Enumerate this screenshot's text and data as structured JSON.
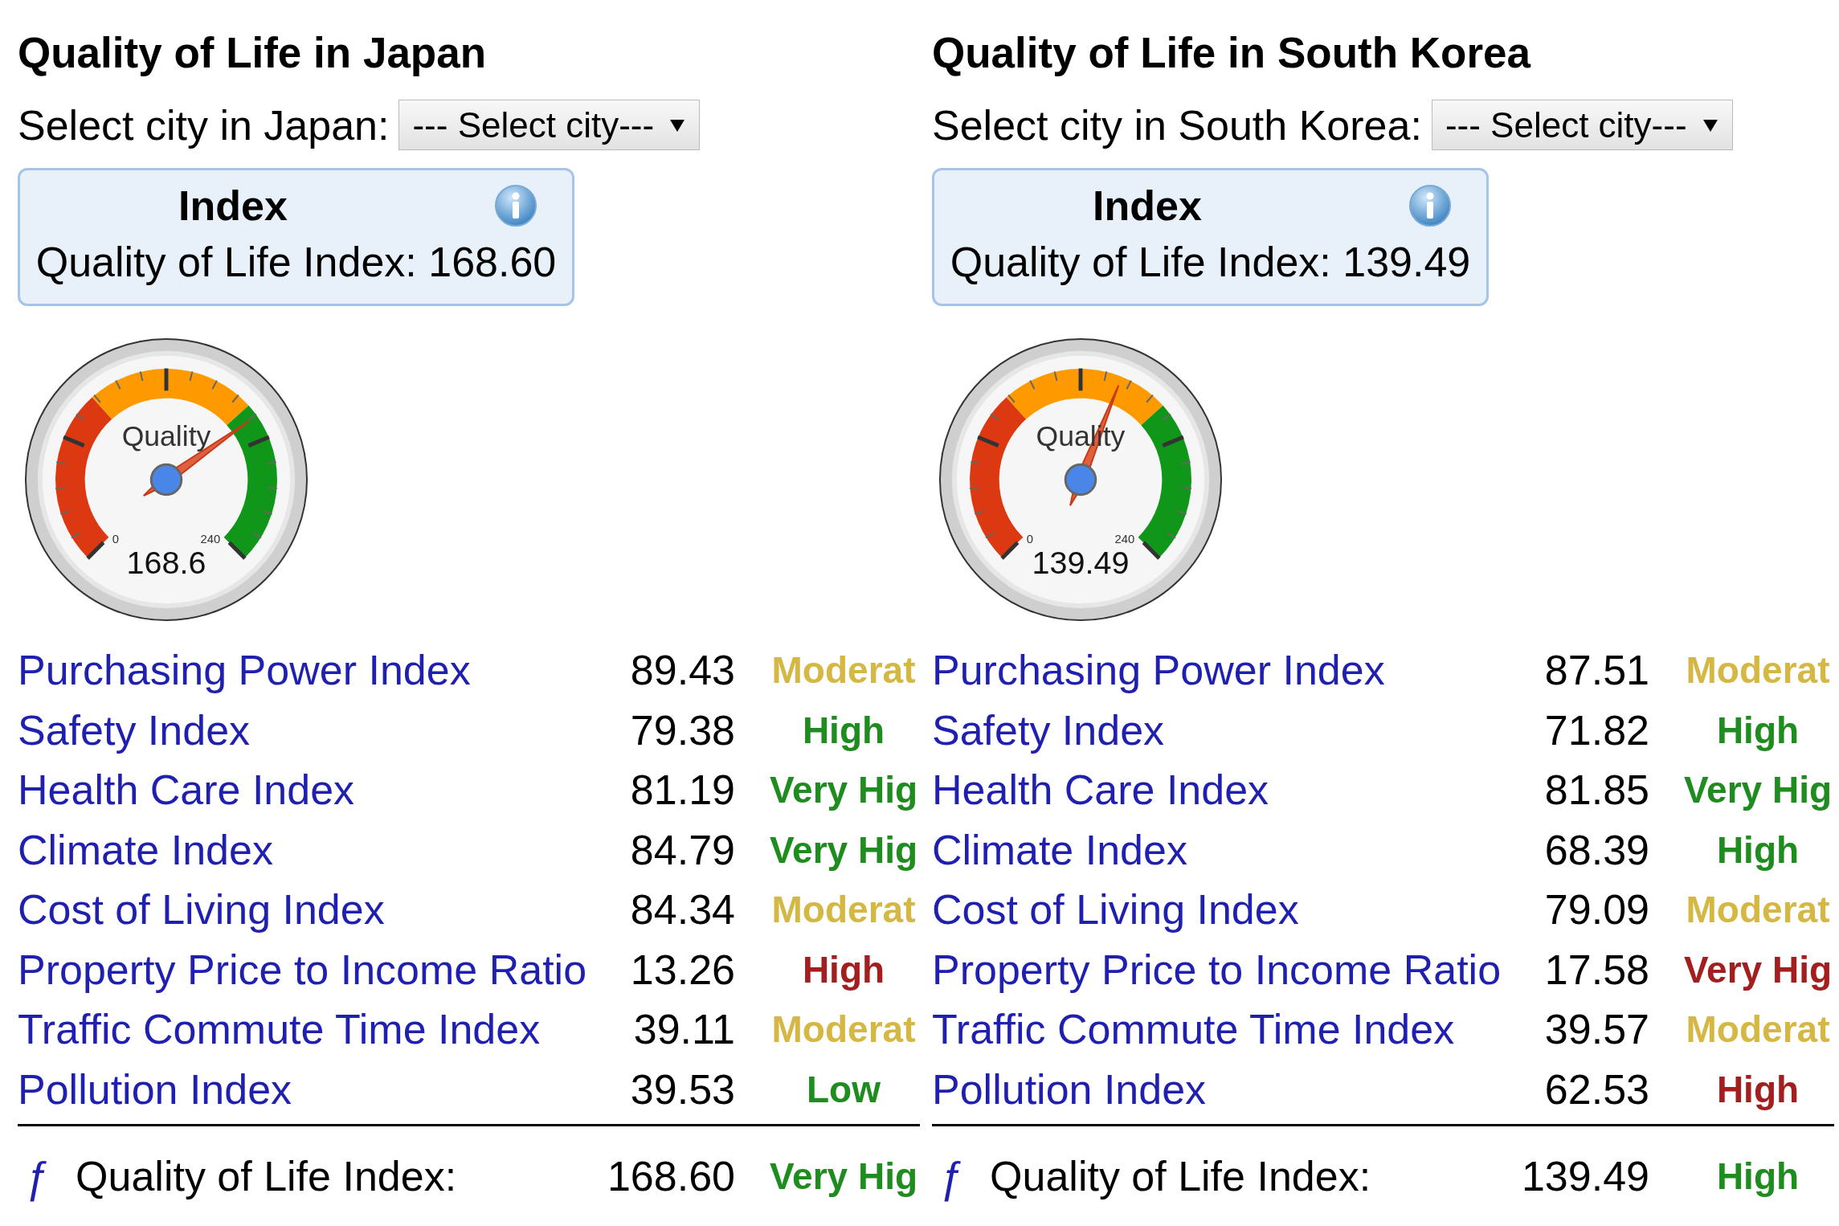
{
  "panels": [
    {
      "title": "Quality of Life in Japan",
      "select": {
        "label": "Select city in Japan:",
        "value": "--- Select city---"
      },
      "index_card": {
        "heading": "Index",
        "text": "Quality of Life Index: 168.60"
      },
      "gauge": {
        "label": "Quality",
        "min_label": "0",
        "max_label": "240",
        "value": "168.6"
      },
      "rows": [
        {
          "name": "Purchasing Power Index",
          "value": "89.43",
          "rating": "Moderat",
          "color": "#d4b843"
        },
        {
          "name": "Safety Index",
          "value": "79.38",
          "rating": "High",
          "color": "#1e8c1e"
        },
        {
          "name": "Health Care Index",
          "value": "81.19",
          "rating": "Very Hig",
          "color": "#1e8c1e"
        },
        {
          "name": "Climate Index",
          "value": "84.79",
          "rating": "Very Hig",
          "color": "#1e8c1e"
        },
        {
          "name": "Cost of Living Index",
          "value": "84.34",
          "rating": "Moderat",
          "color": "#d4b843"
        },
        {
          "name": "Property Price to Income Ratio",
          "value": "13.26",
          "rating": "High",
          "color": "#a31f1f"
        },
        {
          "name": "Traffic Commute Time Index",
          "value": "39.11",
          "rating": "Moderat",
          "color": "#d4b843"
        },
        {
          "name": "Pollution Index",
          "value": "39.53",
          "rating": "Low",
          "color": "#1e8c1e"
        }
      ],
      "total": {
        "symbol": "ƒ",
        "label": "Quality of Life Index:",
        "value": "168.60",
        "rating": "Very Hig",
        "color": "#1e8c1e"
      }
    },
    {
      "title": "Quality of Life in South Korea",
      "select": {
        "label": "Select city in South Korea:",
        "value": "--- Select city---"
      },
      "index_card": {
        "heading": "Index",
        "text": "Quality of Life Index: 139.49"
      },
      "gauge": {
        "label": "Quality",
        "min_label": "0",
        "max_label": "240",
        "value": "139.49"
      },
      "rows": [
        {
          "name": "Purchasing Power Index",
          "value": "87.51",
          "rating": "Moderat",
          "color": "#d4b843"
        },
        {
          "name": "Safety Index",
          "value": "71.82",
          "rating": "High",
          "color": "#1e8c1e"
        },
        {
          "name": "Health Care Index",
          "value": "81.85",
          "rating": "Very Hig",
          "color": "#1e8c1e"
        },
        {
          "name": "Climate Index",
          "value": "68.39",
          "rating": "High",
          "color": "#1e8c1e"
        },
        {
          "name": "Cost of Living Index",
          "value": "79.09",
          "rating": "Moderat",
          "color": "#d4b843"
        },
        {
          "name": "Property Price to Income Ratio",
          "value": "17.58",
          "rating": "Very Hig",
          "color": "#a31f1f"
        },
        {
          "name": "Traffic Commute Time Index",
          "value": "39.57",
          "rating": "Moderat",
          "color": "#d4b843"
        },
        {
          "name": "Pollution Index",
          "value": "62.53",
          "rating": "High",
          "color": "#a31f1f"
        }
      ],
      "total": {
        "symbol": "ƒ",
        "label": "Quality of Life Index:",
        "value": "139.49",
        "rating": "High",
        "color": "#1e8c1e"
      }
    }
  ]
}
